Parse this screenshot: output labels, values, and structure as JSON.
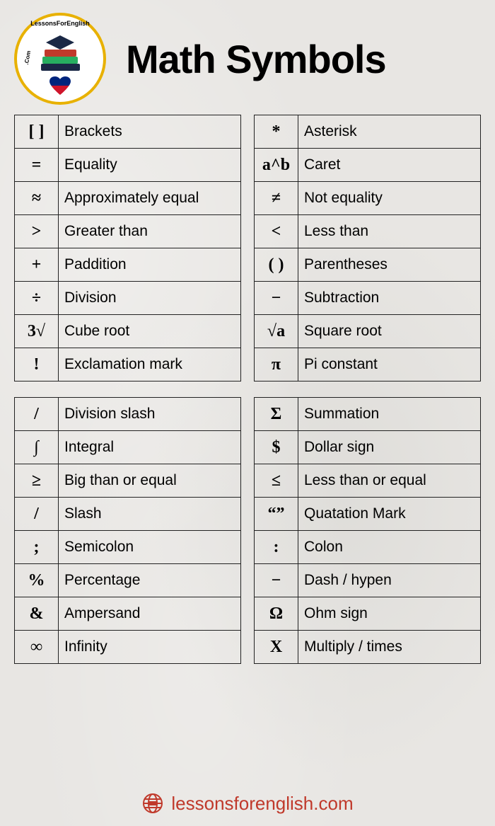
{
  "header": {
    "title": "Math Symbols",
    "logo_text": "LessonsForEnglish.Com"
  },
  "tables": {
    "top_left": [
      {
        "symbol": "[ ]",
        "name": "Brackets"
      },
      {
        "symbol": "=",
        "name": "Equality"
      },
      {
        "symbol": "≈",
        "name": "Approximately equal"
      },
      {
        "symbol": ">",
        "name": "Greater than"
      },
      {
        "symbol": "+",
        "name": "Paddition"
      },
      {
        "symbol": "÷",
        "name": "Division"
      },
      {
        "symbol": "3√",
        "name": "Cube root"
      },
      {
        "symbol": "!",
        "name": "Exclamation mark"
      }
    ],
    "top_right": [
      {
        "symbol": "*",
        "name": "Asterisk"
      },
      {
        "symbol": "a^b",
        "name": "Caret"
      },
      {
        "symbol": "≠",
        "name": "Not equality"
      },
      {
        "symbol": "<",
        "name": "Less than"
      },
      {
        "symbol": "( )",
        "name": "Parentheses"
      },
      {
        "symbol": "−",
        "name": "Subtraction"
      },
      {
        "symbol": "√a",
        "name": "Square root"
      },
      {
        "symbol": "π",
        "name": "Pi constant"
      }
    ],
    "bottom_left": [
      {
        "symbol": "/",
        "name": "Division slash"
      },
      {
        "symbol": "∫",
        "name": "Integral"
      },
      {
        "symbol": "≥",
        "name": "Big than or equal"
      },
      {
        "symbol": "/",
        "name": "Slash"
      },
      {
        "symbol": ";",
        "name": "Semicolon"
      },
      {
        "symbol": "%",
        "name": "Percentage"
      },
      {
        "symbol": "&",
        "name": "Ampersand"
      },
      {
        "symbol": "∞",
        "name": "Infinity"
      }
    ],
    "bottom_right": [
      {
        "symbol": "Σ",
        "name": "Summation"
      },
      {
        "symbol": "$",
        "name": "Dollar sign"
      },
      {
        "symbol": "≤",
        "name": "Less than or equal"
      },
      {
        "symbol": "“”",
        "name": "Quatation Mark"
      },
      {
        "symbol": ":",
        "name": "Colon"
      },
      {
        "symbol": "−",
        "name": "Dash / hypen"
      },
      {
        "symbol": "Ω",
        "name": "Ohm sign"
      },
      {
        "symbol": "X",
        "name": "Multiply / times"
      }
    ]
  },
  "footer": {
    "url": "lessonsforenglish.com"
  }
}
